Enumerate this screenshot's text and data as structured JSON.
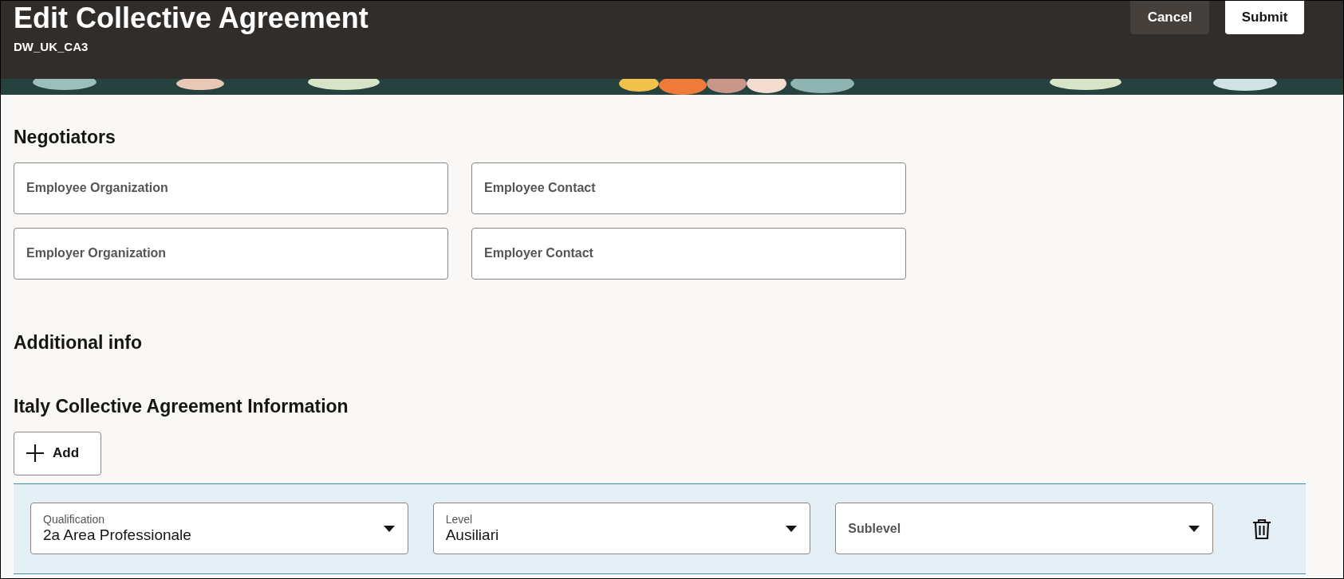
{
  "header": {
    "title": "Edit Collective Agreement",
    "subtitle": "DW_UK_CA3",
    "buttons": [
      {
        "label": "Cancel",
        "kind": "secondary"
      },
      {
        "label": "Submit",
        "kind": "primary"
      }
    ]
  },
  "negotiators": {
    "heading": "Negotiators",
    "fields": [
      {
        "placeholder": "Employee Organization"
      },
      {
        "placeholder": "Employee Contact"
      },
      {
        "placeholder": "Employer Organization"
      },
      {
        "placeholder": "Employer Contact"
      }
    ]
  },
  "additional_info": {
    "heading": "Additional info"
  },
  "italy": {
    "heading": "Italy Collective Agreement Information",
    "add_button": "Add",
    "row": {
      "selects": [
        {
          "label": "Qualification",
          "value": "2a Area Professionale"
        },
        {
          "label": "Level",
          "value": "Ausiliari"
        },
        {
          "placeholder": "Sublevel"
        }
      ]
    }
  }
}
